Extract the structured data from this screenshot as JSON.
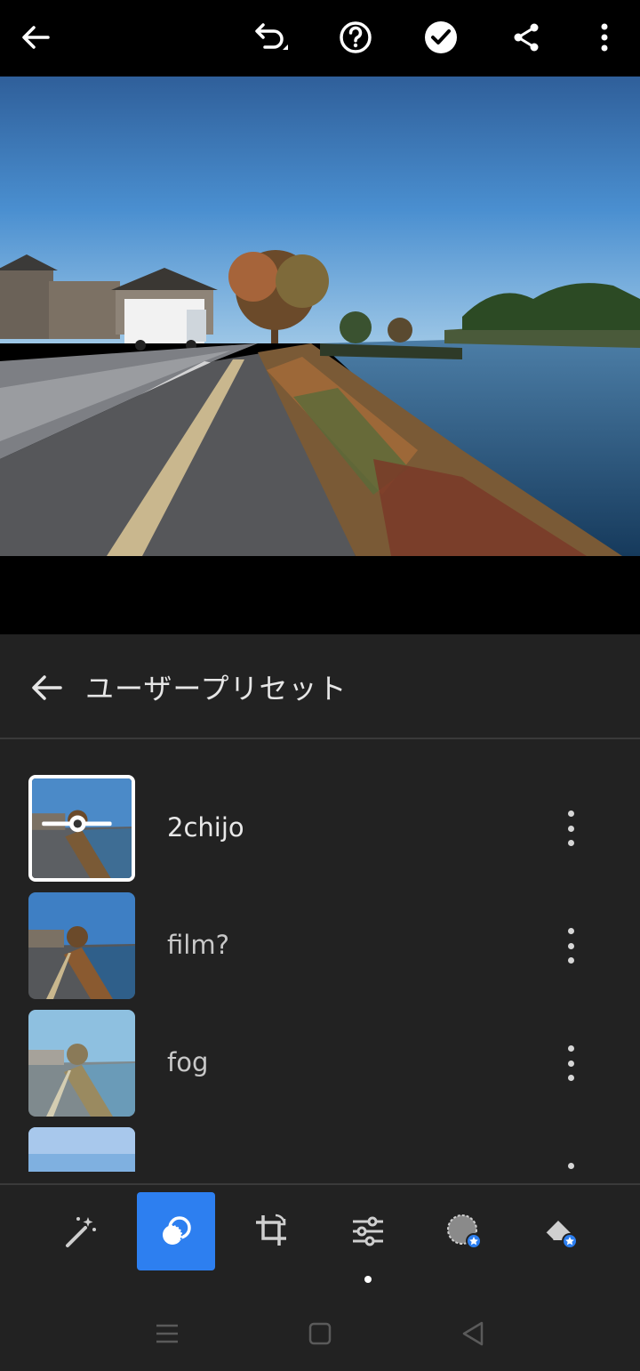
{
  "toolbar": {
    "icons": [
      "back-arrow-icon",
      "undo-icon",
      "help-icon",
      "checkmark-icon",
      "share-icon",
      "more-vertical-icon"
    ]
  },
  "panel": {
    "title": "ユーザープリセット"
  },
  "presets": [
    {
      "name": "2chijo",
      "selected": true
    },
    {
      "name": "film?",
      "selected": false
    },
    {
      "name": "fog",
      "selected": false
    },
    {
      "name": "",
      "selected": false
    }
  ],
  "tools": {
    "icons": [
      "auto-wand-icon",
      "presets-icon",
      "crop-icon",
      "adjust-sliders-icon",
      "selective-icon",
      "healing-eraser-icon"
    ],
    "active": "presets-icon"
  },
  "navbar": {
    "icons": [
      "recents-icon",
      "home-icon",
      "back-triangle-icon"
    ]
  },
  "colors": {
    "accent": "#2d7ff0",
    "panel_bg": "#222222",
    "premium_badge": "#2d7ff0"
  }
}
